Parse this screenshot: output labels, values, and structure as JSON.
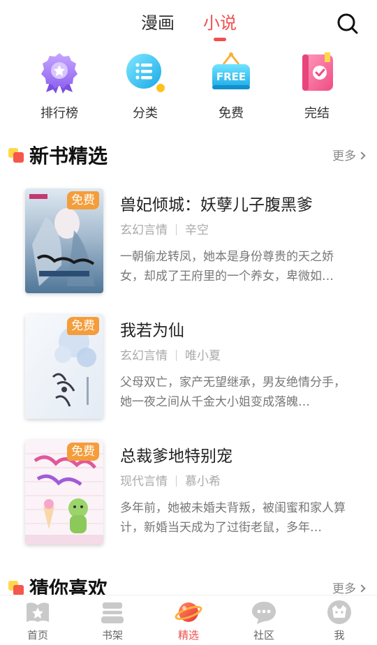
{
  "top_tabs": {
    "comic": "漫画",
    "novel": "小说"
  },
  "quick_entries": [
    {
      "label": "排行榜",
      "icon": "ranking-medal-icon"
    },
    {
      "label": "分类",
      "icon": "category-list-icon"
    },
    {
      "label": "免费",
      "icon": "free-tag-icon",
      "icon_text": "FREE"
    },
    {
      "label": "完结",
      "icon": "finished-book-icon"
    }
  ],
  "sections": {
    "new_books": {
      "title": "新书精选",
      "more": "更多"
    },
    "guess_you_like": {
      "title": "猜你喜欢",
      "more": "更多"
    }
  },
  "books": [
    {
      "title": "兽妃倾城：妖孽儿子腹黑爹",
      "genre": "玄幻言情",
      "author": "辛空",
      "desc": "一朝偷龙转凤，她本是身份尊贵的天之娇女，却成了王府里的一个养女，卑微如…",
      "badge": "免费"
    },
    {
      "title": "我若为仙",
      "genre": "玄幻言情",
      "author": "唯小夏",
      "desc": "父母双亡，家产无望继承，男友绝情分手，她一夜之间从千金大小姐变成落魄…",
      "badge": "免费"
    },
    {
      "title": "总裁爹地特别宠",
      "genre": "现代言情",
      "author": "慕小希",
      "desc": "多年前，她被未婚夫背叛，被闺蜜和家人算计，新婚当天成为了过街老鼠，多年…",
      "badge": "免费"
    }
  ],
  "bottom_nav": [
    {
      "label": "首页",
      "icon": "home-icon"
    },
    {
      "label": "书架",
      "icon": "bookshelf-icon"
    },
    {
      "label": "精选",
      "icon": "planet-icon",
      "active": true
    },
    {
      "label": "社区",
      "icon": "chat-bubble-icon"
    },
    {
      "label": "我",
      "icon": "profile-icon"
    }
  ],
  "colors": {
    "accent": "#ef4f4f",
    "badge": "#f49d3a",
    "section_mark_yellow": "#ffd84a",
    "section_mark_red": "#f5574b"
  }
}
